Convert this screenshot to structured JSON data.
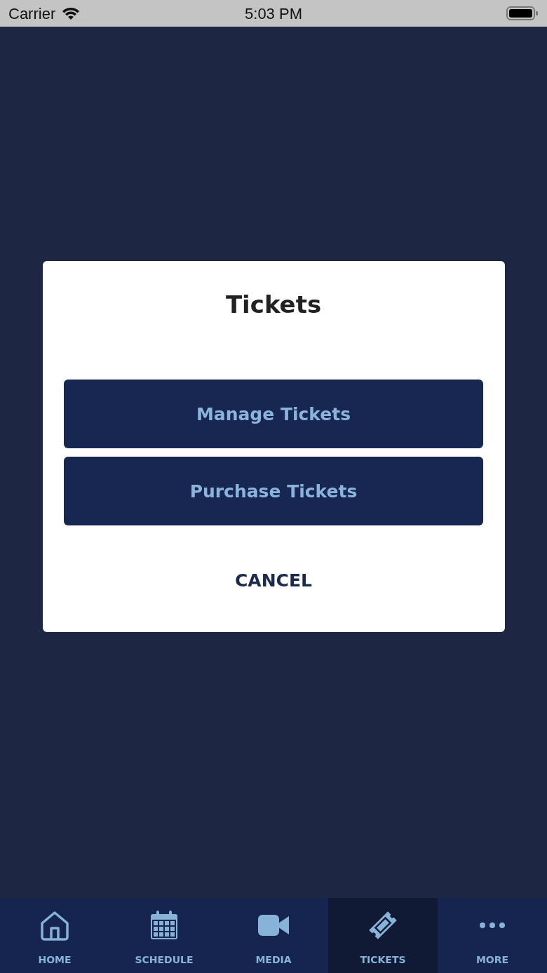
{
  "status_bar": {
    "carrier": "Carrier",
    "time": "5:03 PM"
  },
  "dialog": {
    "title": "Tickets",
    "buttons": [
      "Manage Tickets",
      "Purchase Tickets"
    ],
    "cancel": "CANCEL"
  },
  "tab_bar": [
    {
      "kind": "home",
      "label": "HOME",
      "selected": false
    },
    {
      "kind": "schedule",
      "label": "SCHEDULE",
      "selected": false
    },
    {
      "kind": "media",
      "label": "MEDIA",
      "selected": false
    },
    {
      "kind": "tickets",
      "label": "TICKETS",
      "selected": true
    },
    {
      "kind": "more",
      "label": "MORE",
      "selected": false
    }
  ]
}
